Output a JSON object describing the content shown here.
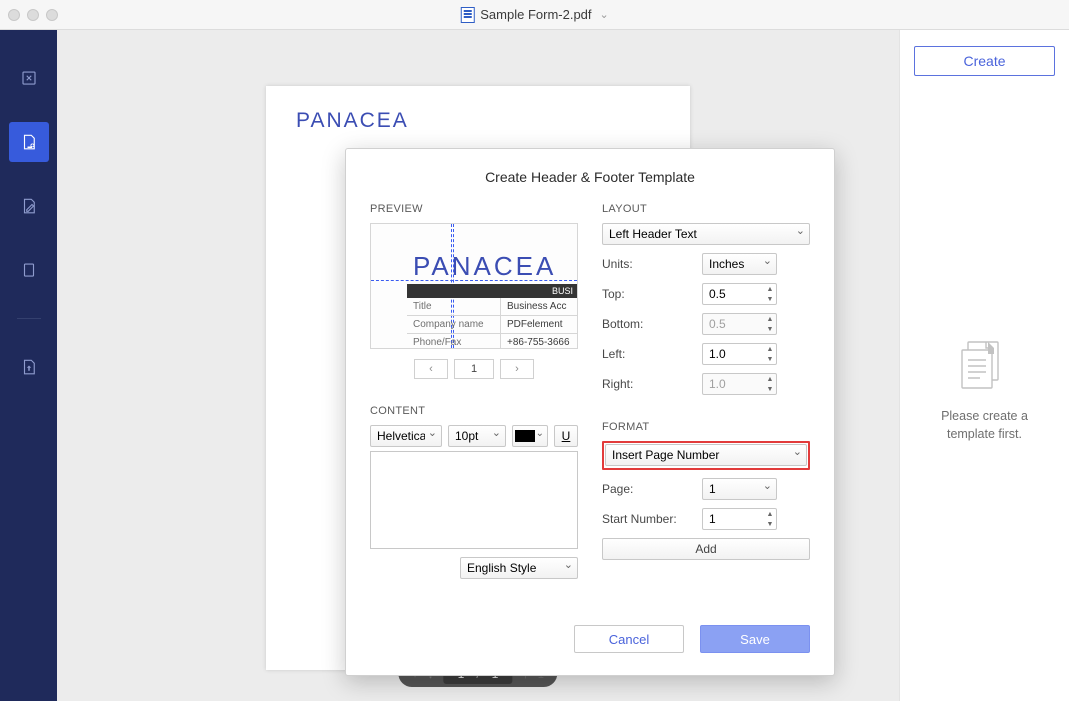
{
  "window": {
    "title": "Sample Form-2.pdf"
  },
  "sidebar": {
    "items": [
      {
        "name": "tool-close"
      },
      {
        "name": "tool-header-footer",
        "active": true
      },
      {
        "name": "tool-edit"
      },
      {
        "name": "tool-page"
      },
      {
        "name": "tool-export"
      }
    ]
  },
  "document": {
    "brand": "PANACEA",
    "nav": {
      "current": "1",
      "separator": "/",
      "total": "1"
    }
  },
  "rightpanel": {
    "create": "Create",
    "placeholder_l1": "Please create a",
    "placeholder_l2": "template first."
  },
  "modal": {
    "title": "Create Header & Footer Template",
    "preview": {
      "label": "PREVIEW",
      "brand": "PANACEA",
      "bar_text": "BUSI",
      "rows": [
        {
          "left": "Title",
          "right": "Business Acc"
        },
        {
          "left": "Company name",
          "right": "PDFelement"
        },
        {
          "left": "Phone/Fax",
          "right": "+86-755-3666"
        }
      ],
      "page_num": "1"
    },
    "content": {
      "label": "CONTENT",
      "font": "Helvetica",
      "size": "10pt",
      "color": "#000000",
      "underline": "U",
      "text": "",
      "style": "English Style"
    },
    "layout": {
      "label": "LAYOUT",
      "position": "Left Header Text",
      "units_label": "Units:",
      "units": "Inches",
      "top_label": "Top:",
      "top": "0.5",
      "bottom_label": "Bottom:",
      "bottom": "0.5",
      "left_label": "Left:",
      "left": "1.0",
      "right_label": "Right:",
      "right": "1.0"
    },
    "format": {
      "label": "FORMAT",
      "insert": "Insert Page Number",
      "page_label": "Page:",
      "page": "1",
      "start_label": "Start Number:",
      "start": "1",
      "add": "Add"
    },
    "footer": {
      "cancel": "Cancel",
      "save": "Save"
    }
  }
}
